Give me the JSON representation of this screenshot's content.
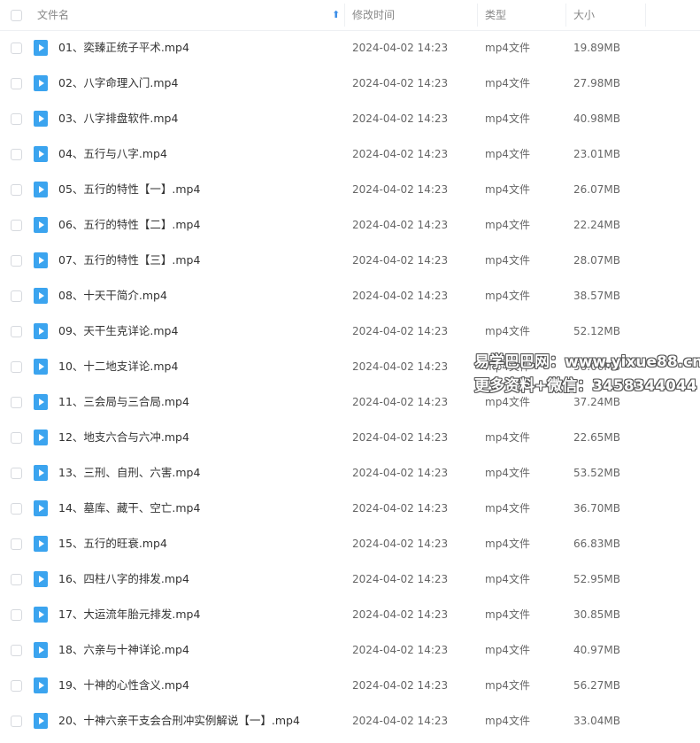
{
  "header": {
    "name": "文件名",
    "modified": "修改时间",
    "type": "类型",
    "size": "大小",
    "sort_arrow": "⬆"
  },
  "files": [
    {
      "name": "01、奕臻正统子平术.mp4",
      "time": "2024-04-02 14:23",
      "type": "mp4文件",
      "size": "19.89MB"
    },
    {
      "name": "02、八字命理入门.mp4",
      "time": "2024-04-02 14:23",
      "type": "mp4文件",
      "size": "27.98MB"
    },
    {
      "name": "03、八字排盘软件.mp4",
      "time": "2024-04-02 14:23",
      "type": "mp4文件",
      "size": "40.98MB"
    },
    {
      "name": "04、五行与八字.mp4",
      "time": "2024-04-02 14:23",
      "type": "mp4文件",
      "size": "23.01MB"
    },
    {
      "name": "05、五行的特性【一】.mp4",
      "time": "2024-04-02 14:23",
      "type": "mp4文件",
      "size": "26.07MB"
    },
    {
      "name": "06、五行的特性【二】.mp4",
      "time": "2024-04-02 14:23",
      "type": "mp4文件",
      "size": "22.24MB"
    },
    {
      "name": "07、五行的特性【三】.mp4",
      "time": "2024-04-02 14:23",
      "type": "mp4文件",
      "size": "28.07MB"
    },
    {
      "name": "08、十天干简介.mp4",
      "time": "2024-04-02 14:23",
      "type": "mp4文件",
      "size": "38.57MB"
    },
    {
      "name": "09、天干生克详论.mp4",
      "time": "2024-04-02 14:23",
      "type": "mp4文件",
      "size": "52.12MB"
    },
    {
      "name": "10、十二地支详论.mp4",
      "time": "2024-04-02 14:23",
      "type": "mp4文件",
      "size": "58.06MB"
    },
    {
      "name": "11、三会局与三合局.mp4",
      "time": "2024-04-02 14:23",
      "type": "mp4文件",
      "size": "37.24MB"
    },
    {
      "name": "12、地支六合与六冲.mp4",
      "time": "2024-04-02 14:23",
      "type": "mp4文件",
      "size": "22.65MB"
    },
    {
      "name": "13、三刑、自刑、六害.mp4",
      "time": "2024-04-02 14:23",
      "type": "mp4文件",
      "size": "53.52MB"
    },
    {
      "name": "14、墓库、藏干、空亡.mp4",
      "time": "2024-04-02 14:23",
      "type": "mp4文件",
      "size": "36.70MB"
    },
    {
      "name": "15、五行的旺衰.mp4",
      "time": "2024-04-02 14:23",
      "type": "mp4文件",
      "size": "66.83MB"
    },
    {
      "name": "16、四柱八字的排发.mp4",
      "time": "2024-04-02 14:23",
      "type": "mp4文件",
      "size": "52.95MB"
    },
    {
      "name": "17、大运流年胎元排发.mp4",
      "time": "2024-04-02 14:23",
      "type": "mp4文件",
      "size": "30.85MB"
    },
    {
      "name": "18、六亲与十神详论.mp4",
      "time": "2024-04-02 14:23",
      "type": "mp4文件",
      "size": "40.97MB"
    },
    {
      "name": "19、十神的心性含义.mp4",
      "time": "2024-04-02 14:23",
      "type": "mp4文件",
      "size": "56.27MB"
    },
    {
      "name": "20、十神六亲干支会合刑冲实例解说【一】.mp4",
      "time": "2024-04-02 14:23",
      "type": "mp4文件",
      "size": "33.04MB"
    }
  ],
  "watermark": {
    "line1": "易学巴巴网：www.yixue88.cn",
    "line2": "更多资料+微信：3458344044"
  },
  "colors": {
    "accent": "#3b8ee8",
    "file_icon": "#3ba4ef"
  }
}
